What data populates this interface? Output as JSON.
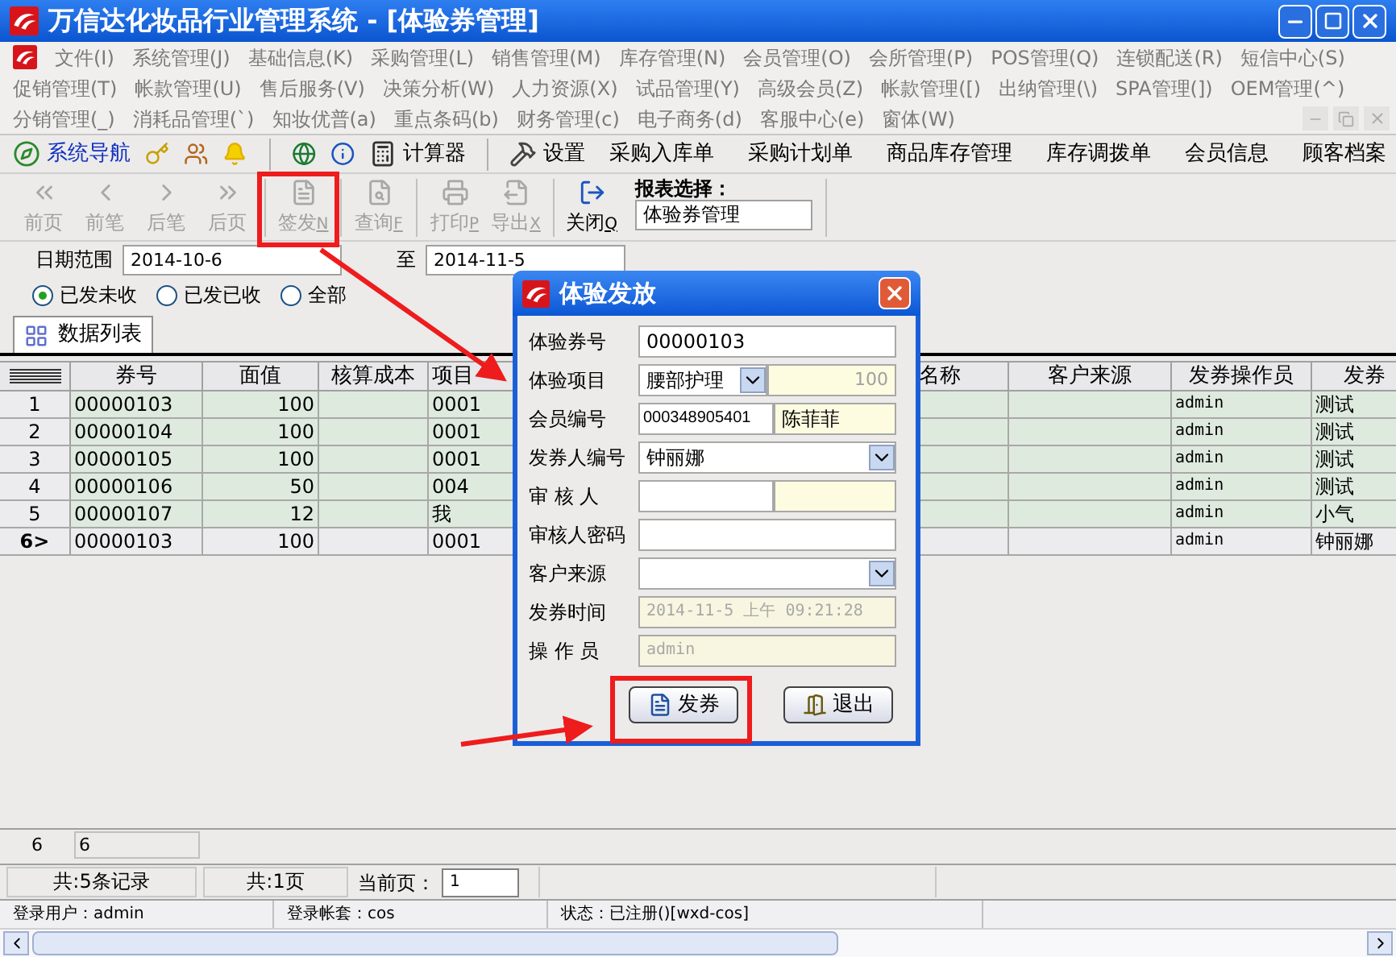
{
  "window": {
    "title": "万信达化妆品行业管理系统 - [体验券管理]"
  },
  "menu_rows": [
    {
      "items": [
        "文件(I)",
        "系统管理(J)",
        "基础信息(K)",
        "采购管理(L)",
        "销售管理(M)",
        "库存管理(N)",
        "会员管理(O)",
        "会所管理(P)",
        "POS管理(Q)",
        "连锁配送(R)",
        "短信中心(S)"
      ]
    },
    {
      "items": [
        "促销管理(T)",
        "帐款管理(U)",
        "售后服务(V)",
        "决策分析(W)",
        "人力资源(X)",
        "试品管理(Y)",
        "高级会员(Z)",
        "帐款管理([)",
        "出纳管理(\\)",
        "SPA管理(])",
        "OEM管理(^)"
      ]
    },
    {
      "items": [
        "分销管理(_)",
        "消耗品管理(`)",
        "知妆优普(a)",
        "重点条码(b)",
        "财务管理(c)",
        "电子商务(d)",
        "客服中心(e)",
        "窗体(W)"
      ]
    }
  ],
  "nav_toolbar": [
    {
      "kind": "nav",
      "label": "系统导航"
    },
    {
      "kind": "key"
    },
    {
      "kind": "people"
    },
    {
      "kind": "bell"
    },
    {
      "kind": "separator"
    },
    {
      "kind": "globe"
    },
    {
      "kind": "info"
    },
    {
      "kind": "calc",
      "label": "计算器"
    },
    {
      "kind": "separator"
    },
    {
      "kind": "hammer",
      "label": "设置"
    },
    {
      "kind": "text",
      "label": "采购入库单"
    },
    {
      "kind": "text",
      "label": "采购计划单"
    },
    {
      "kind": "text",
      "label": "商品库存管理"
    },
    {
      "kind": "text",
      "label": "库存调拨单"
    },
    {
      "kind": "text",
      "label": "会员信息"
    },
    {
      "kind": "text",
      "label": "顾客档案"
    }
  ],
  "action_toolbar": [
    {
      "kind": "first",
      "label": "前页",
      "disabled": true
    },
    {
      "kind": "prev",
      "label": "前笔",
      "disabled": true
    },
    {
      "kind": "next",
      "label": "后笔",
      "disabled": true
    },
    {
      "kind": "last",
      "label": "后页",
      "disabled": true
    },
    {
      "kind": "issue",
      "label": "签发",
      "key": "N",
      "disabled": true
    },
    {
      "kind": "query",
      "label": "查询",
      "key": "F",
      "disabled": true
    },
    {
      "kind": "print",
      "label": "打印",
      "key": "P",
      "disabled": true
    },
    {
      "kind": "export",
      "label": "导出",
      "key": "X",
      "disabled": true
    },
    {
      "kind": "close",
      "label": "关闭",
      "key": "Q",
      "disabled": false
    }
  ],
  "report_select": {
    "label": "报表选择：",
    "value": "体验券管理"
  },
  "date_range": {
    "label": "日期范围",
    "from": "2014-10-6",
    "to_label": "至",
    "to": "2014-11-5"
  },
  "filters": [
    {
      "label": "已发未收",
      "selected": true
    },
    {
      "label": "已发已收",
      "selected": false
    },
    {
      "label": "全部",
      "selected": false
    }
  ],
  "tab": {
    "label": "数据列表"
  },
  "table": {
    "columns": [
      "券号",
      "面值",
      "核算成本",
      "项目",
      "名称",
      "客户来源",
      "发券操作员",
      "发券"
    ],
    "rows": [
      {
        "row_header": "1",
        "selected": false,
        "cells": [
          "00000103",
          "100",
          "",
          "0001",
          "",
          "",
          "admin",
          "测试"
        ]
      },
      {
        "row_header": "2",
        "selected": false,
        "cells": [
          "00000104",
          "100",
          "",
          "0001",
          "",
          "",
          "admin",
          "测试"
        ]
      },
      {
        "row_header": "3",
        "selected": false,
        "cells": [
          "00000105",
          "100",
          "",
          "0001",
          "",
          "",
          "admin",
          "测试"
        ]
      },
      {
        "row_header": "4",
        "selected": false,
        "cells": [
          "00000106",
          "50",
          "",
          "004",
          "",
          "",
          "admin",
          "测试"
        ]
      },
      {
        "row_header": "5",
        "selected": false,
        "cells": [
          "00000107",
          "12",
          "",
          "我",
          "",
          "",
          "admin",
          "小气"
        ]
      },
      {
        "row_header": "6>",
        "selected": true,
        "cells": [
          "00000103",
          "100",
          "",
          "0001",
          "",
          "",
          "admin",
          "钟丽娜"
        ]
      }
    ]
  },
  "footer_row": [
    "6",
    "6"
  ],
  "pager": {
    "records": "共:5条记录",
    "pages": "共:1页",
    "current_label": "当前页：",
    "current": "1"
  },
  "status_bar": [
    "登录用户：admin",
    "登录帐套：cos",
    "状态：已注册()[wxd-cos]"
  ],
  "dialog": {
    "title": "体验发放",
    "fields": [
      {
        "kind": "text",
        "label": "体验券号",
        "value": "00000103"
      },
      {
        "kind": "select_extra",
        "label": "体验项目",
        "value": "腰部护理",
        "extra": "100"
      },
      {
        "kind": "pair",
        "label": "会员编号",
        "value": "000348905401",
        "extra": "陈菲菲"
      },
      {
        "kind": "select",
        "label": "发券人编号",
        "value": "钟丽娜"
      },
      {
        "kind": "pair",
        "label": "审 核 人"
      },
      {
        "kind": "text",
        "label": "审核人密码"
      },
      {
        "kind": "select",
        "label": "客户来源"
      },
      {
        "kind": "readonly",
        "label": "发券时间",
        "value": "2014-11-5 上午 09:21:28"
      },
      {
        "kind": "readonly",
        "label": "操 作 员",
        "value": "admin"
      }
    ],
    "buttons": [
      {
        "kind": "issue",
        "label": "发券"
      },
      {
        "kind": "exit",
        "label": "退出"
      }
    ]
  }
}
